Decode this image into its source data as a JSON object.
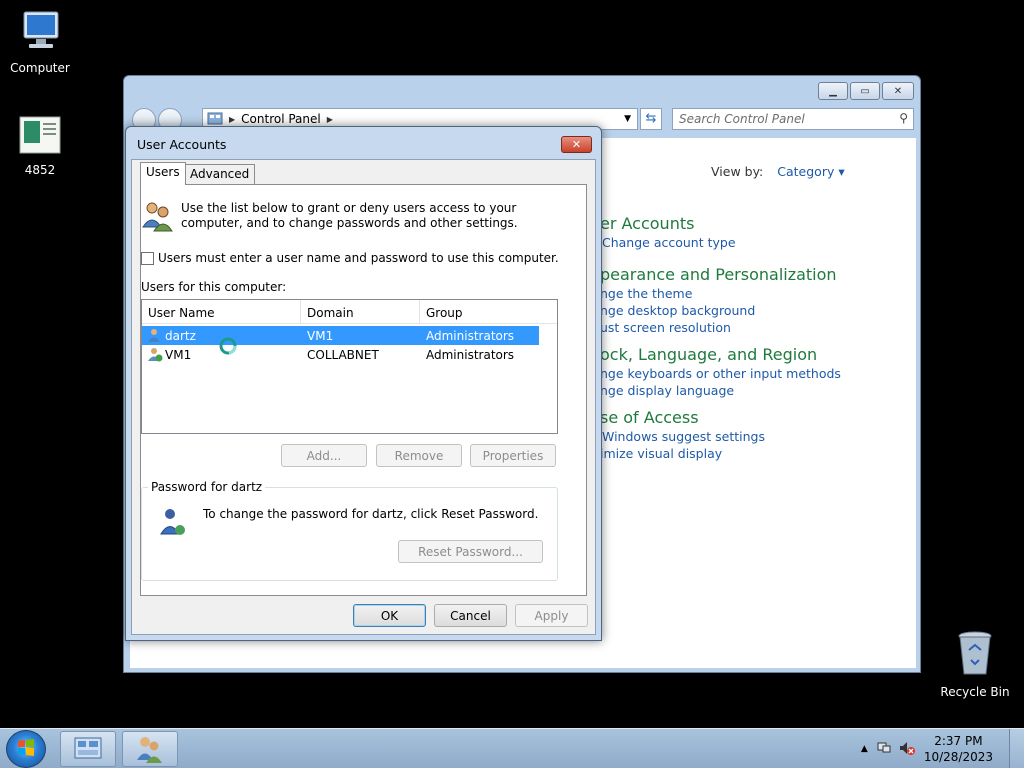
{
  "desktop": {
    "icons": [
      {
        "label": "Computer",
        "icon": "computer-icon"
      },
      {
        "label": "4852",
        "icon": "document-icon"
      },
      {
        "label": "Recycle Bin",
        "icon": "recycle-bin-icon"
      }
    ]
  },
  "control_panel": {
    "breadcrumb": "Control Panel",
    "search_placeholder": "Search Control Panel",
    "view_by_label": "View by:",
    "view_by_value": "Category",
    "categories": [
      {
        "heading": "er Accounts",
        "links": [
          "Change account type"
        ]
      },
      {
        "heading": "pearance and Personalization",
        "links": [
          "nge the theme",
          "nge desktop background",
          "ust screen resolution"
        ]
      },
      {
        "heading": "ock, Language, and Region",
        "links": [
          "nge keyboards or other input methods",
          "nge display language"
        ]
      },
      {
        "heading": "se of Access",
        "links": [
          "Windows suggest settings",
          "imize visual display"
        ]
      }
    ]
  },
  "dialog": {
    "title": "User Accounts",
    "close_glyph": "✕",
    "tabs": [
      "Users",
      "Advanced"
    ],
    "intro": "Use the list below to grant or deny users access to your computer, and to change passwords and other settings.",
    "checkbox_label": "Users must enter a user name and password to use this computer.",
    "checkbox_checked": false,
    "users_label": "Users for this computer:",
    "columns": [
      "User Name",
      "Domain",
      "Group"
    ],
    "rows": [
      {
        "name": "dartz",
        "domain": "VM1",
        "group": "Administrators",
        "selected": true
      },
      {
        "name": "VM1",
        "domain": "COLLABNET",
        "group": "Administrators",
        "selected": false
      }
    ],
    "buttons": {
      "add": "Add...",
      "remove": "Remove",
      "properties": "Properties"
    },
    "password_group": "Password for dartz",
    "password_text": "To change the password for dartz, click Reset Password.",
    "reset_button": "Reset Password...",
    "ok": "OK",
    "cancel": "Cancel",
    "apply": "Apply"
  },
  "taskbar": {
    "time": "2:37 PM",
    "date": "10/28/2023"
  },
  "colors": {
    "accent": "#3399ff",
    "link": "#1e5aa8",
    "category": "#1e7a3e"
  }
}
